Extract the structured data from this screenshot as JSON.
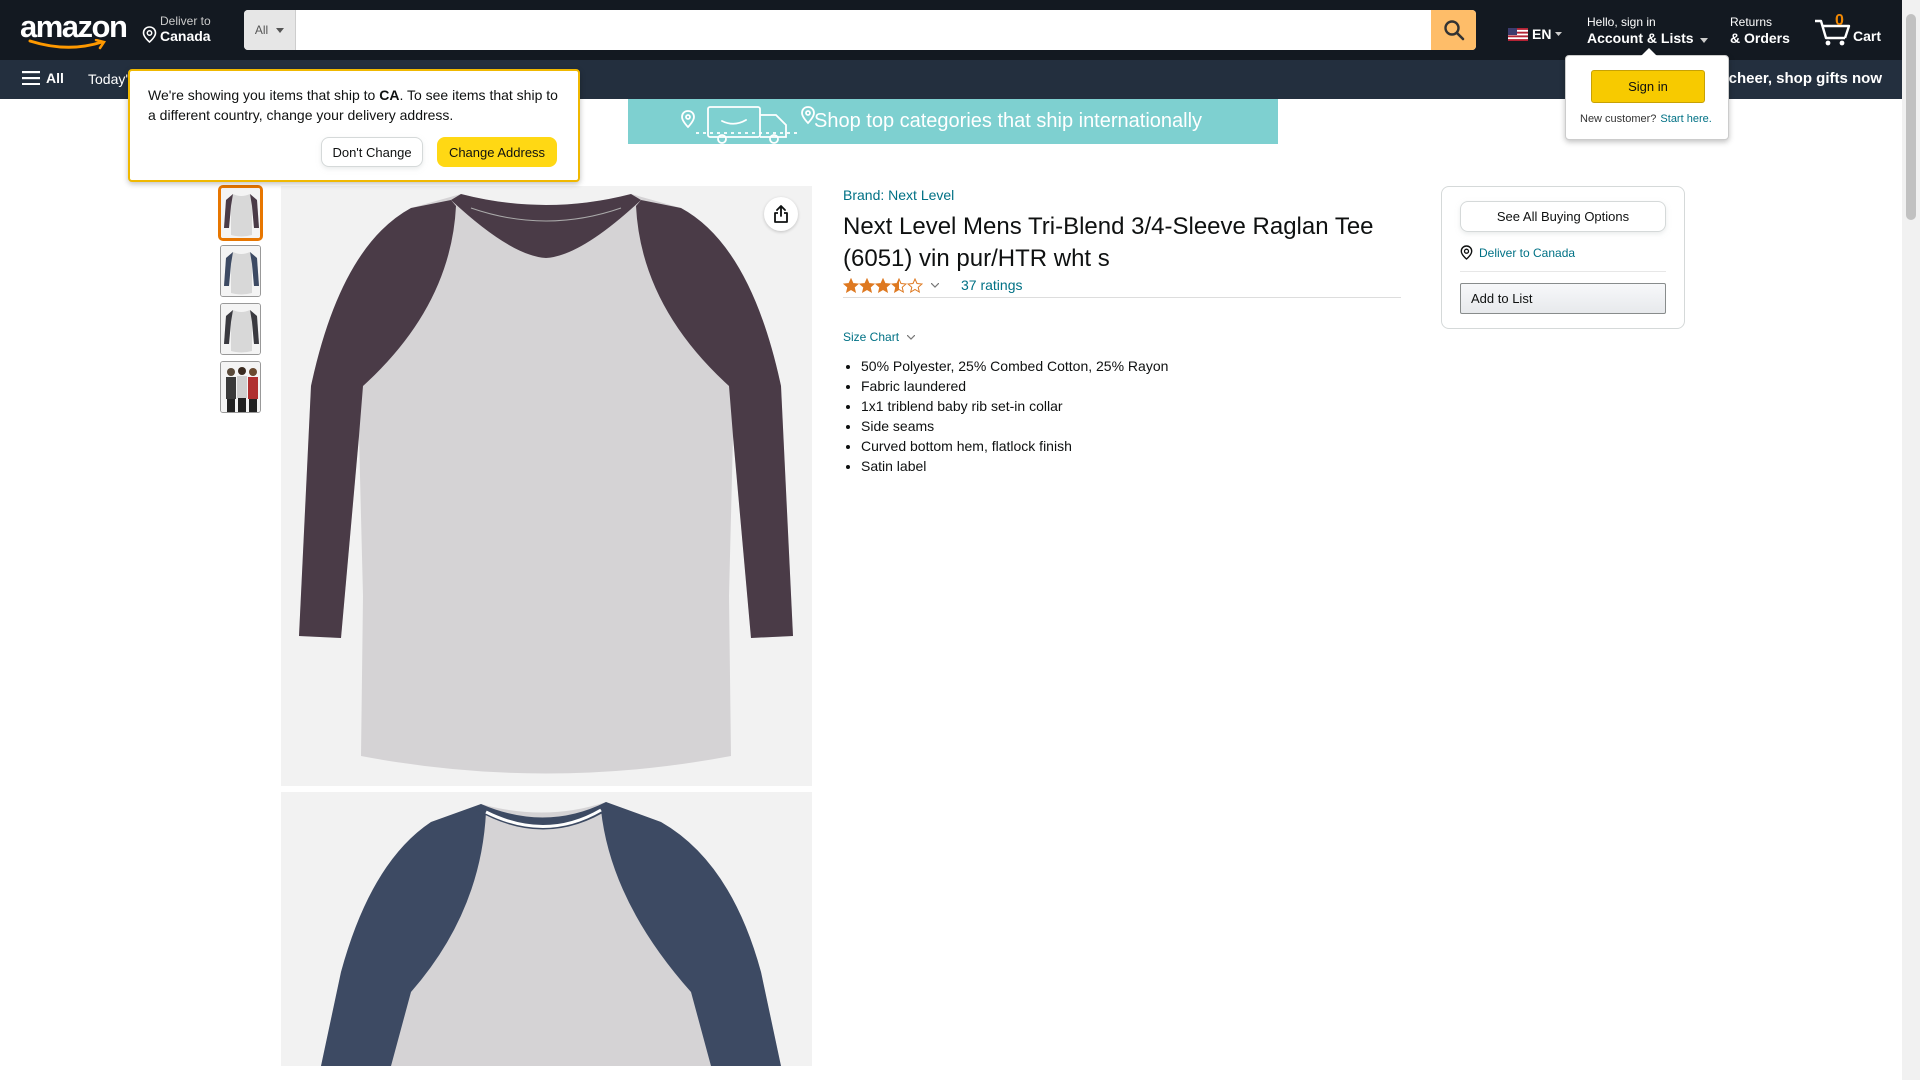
{
  "header": {
    "logo_text": "amazon",
    "deliver_line1": "Deliver to",
    "deliver_line2": "Canada",
    "search_category": "All",
    "search_placeholder": "",
    "lang": "EN",
    "account_line1": "Hello, sign in",
    "account_line2": "Account & Lists",
    "returns_line1": "Returns",
    "returns_line2": "& Orders",
    "cart_count": "0",
    "cart_label": "Cart"
  },
  "subnav": {
    "all_label": "All",
    "today_label": "Today's",
    "promo": "e cheer, shop gifts now"
  },
  "address_popover": {
    "text_before": "We're showing you items that ship to ",
    "country": "CA",
    "text_after": ". To see items that ship to a different country, change your delivery address.",
    "dont_change": "Don't Change",
    "change_address": "Change Address"
  },
  "banner": {
    "text": "Shop top categories that ship internationally"
  },
  "signin_popover": {
    "button": "Sign in",
    "new_customer": "New customer?",
    "start_here": "Start here."
  },
  "product": {
    "brand": "Brand: Next Level",
    "title": "Next Level Mens Tri-Blend 3/4-Sleeve Raglan Tee (6051) vin pur/HTR wht s",
    "rating": 3.5,
    "ratings_count": "37 ratings",
    "size_chart": "Size Chart",
    "bullets": [
      "50% Polyester, 25% Combed Cotton, 25% Rayon",
      "Fabric laundered",
      "1x1 triblend baby rib set-in collar",
      "Side seams",
      "Curved bottom hem, flatlock finish",
      "Satin label"
    ]
  },
  "buybox": {
    "see_all": "See All Buying Options",
    "deliver_to": "Deliver to Canada",
    "add_to_list": "Add to List"
  },
  "colors": {
    "nav_bg": "#131921",
    "subnav_bg": "#232F3E",
    "search_btn": "#FEBD69",
    "accent_yellow": "#FFD814",
    "link": "#007185",
    "star": "#DE7921",
    "sleeve_purple": "#4A3B47",
    "sleeve_navy": "#3D4A63"
  }
}
